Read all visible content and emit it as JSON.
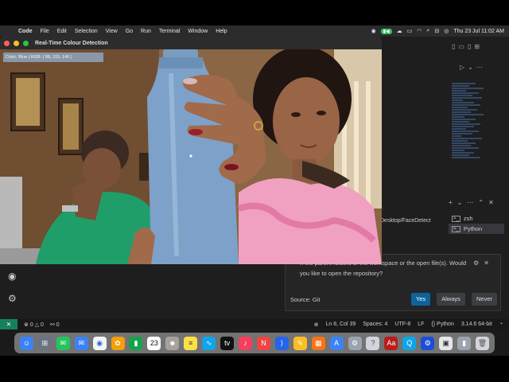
{
  "menubar": {
    "app_name": "Code",
    "menus": [
      "File",
      "Edit",
      "Selection",
      "View",
      "Go",
      "Run",
      "Terminal",
      "Window",
      "Help"
    ],
    "datetime": "Thu 23 Jul  11:02 AM"
  },
  "camera_window": {
    "title": "Real-Time Colour Detection",
    "overlay_text": "Color: Blue | RGB: ( 88, 115, 146 )",
    "detected_color": "#5873 92"
  },
  "terminal": {
    "path_fragment": "Desktop/FaceDetect",
    "instances": [
      {
        "label": "zsh",
        "active": false
      },
      {
        "label": "Python",
        "active": true
      }
    ]
  },
  "toast": {
    "message": "n the parent folders of the workspace or the open file(s). Would you like to open the repository?",
    "source": "Source: Git",
    "yes_label": "Yes",
    "always_label": "Always",
    "never_label": "Never"
  },
  "statusbar": {
    "errors": "0",
    "warnings": "0",
    "ports": "0",
    "position": "Ln 8, Col 39",
    "spaces": "Spaces: 4",
    "encoding": "UTF-8",
    "eol": "LF",
    "language": "Python",
    "interpreter": "3.14.6 64-bit"
  },
  "dock": {
    "calendar_day": "23"
  },
  "colors": {
    "menubar_bg": "#2b2b2e",
    "vscode_bg": "#1e1e1e",
    "accent_blue": "#0e639c",
    "remote_green": "#16825d",
    "facetime_green": "#2fc25a"
  }
}
